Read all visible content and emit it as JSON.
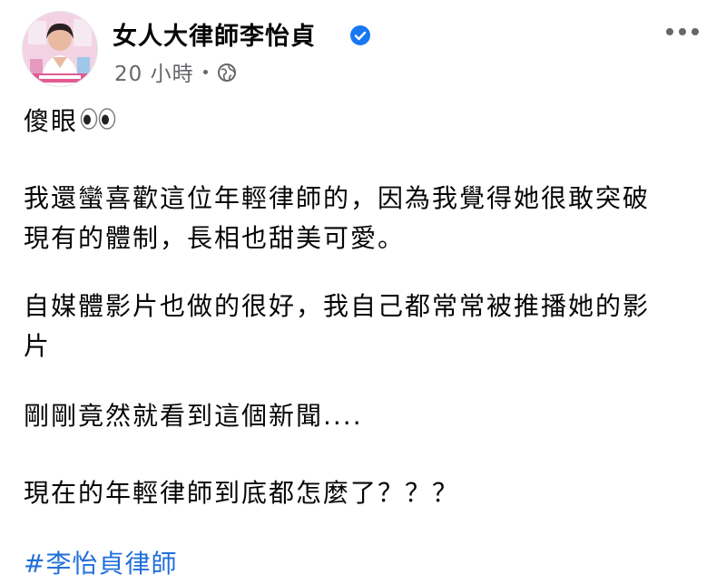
{
  "post": {
    "author_name": "女人大律師李怡貞",
    "time": "20 小時",
    "audience_icon": "globe-icon",
    "verified_icon": "verified-badge-icon",
    "more_icon": "more-options-icon",
    "line1_text": "傻眼",
    "line1_emoji": "eyes-emoji",
    "line2": "我還蠻喜歡這位年輕律師的，因為我覺得她很敢突破",
    "line3": "現有的體制，長相也甜美可愛。",
    "line4": "自媒體影片也做的很好，我自己都常常被推播她的影",
    "line5": "片",
    "line6": "剛剛竟然就看到這個新聞....",
    "line7": "現在的年輕律師到底都怎麼了？？？",
    "hashtag": "#李怡貞律師"
  },
  "colors": {
    "verified": "#1877f2",
    "hashtag": "#216fdb",
    "meta": "#65676b",
    "text": "#050505"
  }
}
